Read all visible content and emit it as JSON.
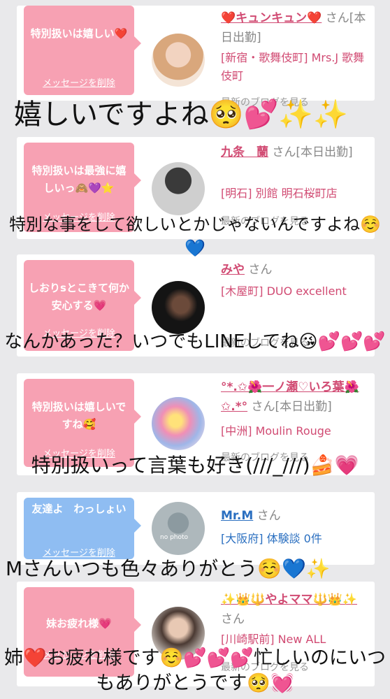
{
  "delete_label": "メッセージを削除",
  "blog_label": "最新のブログを見る",
  "colors": {
    "pink_bubble": "#f7a1b3",
    "blue_bubble": "#8fbdf2",
    "name_pink": "#d14b73",
    "name_blue": "#2a6fc0"
  },
  "cards": [
    {
      "message": "特別扱いは嬉しい❤️",
      "name": "❤️キュンキュン❤️",
      "suffix": "さん[本日出勤]",
      "shop": "[新宿・歌舞伎町] Mrs.J 歌舞伎町"
    },
    {
      "message": "特別扱いは最強に嬉しいっ🙈💜⭐️",
      "name": "九条　蘭",
      "suffix": "さん[本日出勤]",
      "shop": "[明石] 別館 明石桜町店"
    },
    {
      "message": "しおりsとこきて何か安心する💗",
      "name": "みや",
      "suffix": "さん",
      "shop": "[木屋町] DUO excellent"
    },
    {
      "message": "特別扱いは嬉しいですね🥰",
      "name": "°*.✩🌺一ノ瀬♡いろ葉🌺✩.*°",
      "suffix": "さん[本日出勤]",
      "shop": "[中洲] Moulin Rouge"
    },
    {
      "message": "友達よ　わっしょい",
      "name": "Mr.M",
      "suffix": "さん",
      "shop": "[大阪府] 体験談 0件",
      "avatar_text": "no photo"
    },
    {
      "message": "妹お疲れ様💗",
      "name": "✨👑🔱やよママ🔱👑✨",
      "suffix": "さん",
      "shop": "[川崎駅前] New ALL"
    }
  ],
  "overlay_texts": [
    "嬉しいですよね🥺💕✨✨",
    "特別な事をして欲しいとかじゃないんですよね☺️💙",
    "なんかあった？いつでもLINEしてね😘💕💕💕",
    "特別扱いって言葉も好き(///_///)🍰💗",
    "Mさんいつも色々ありがとう☺️💙✨",
    "姉❤️お疲れ様です☺️💕💕💕忙しいのにいつもありがとうです🥺💓"
  ]
}
